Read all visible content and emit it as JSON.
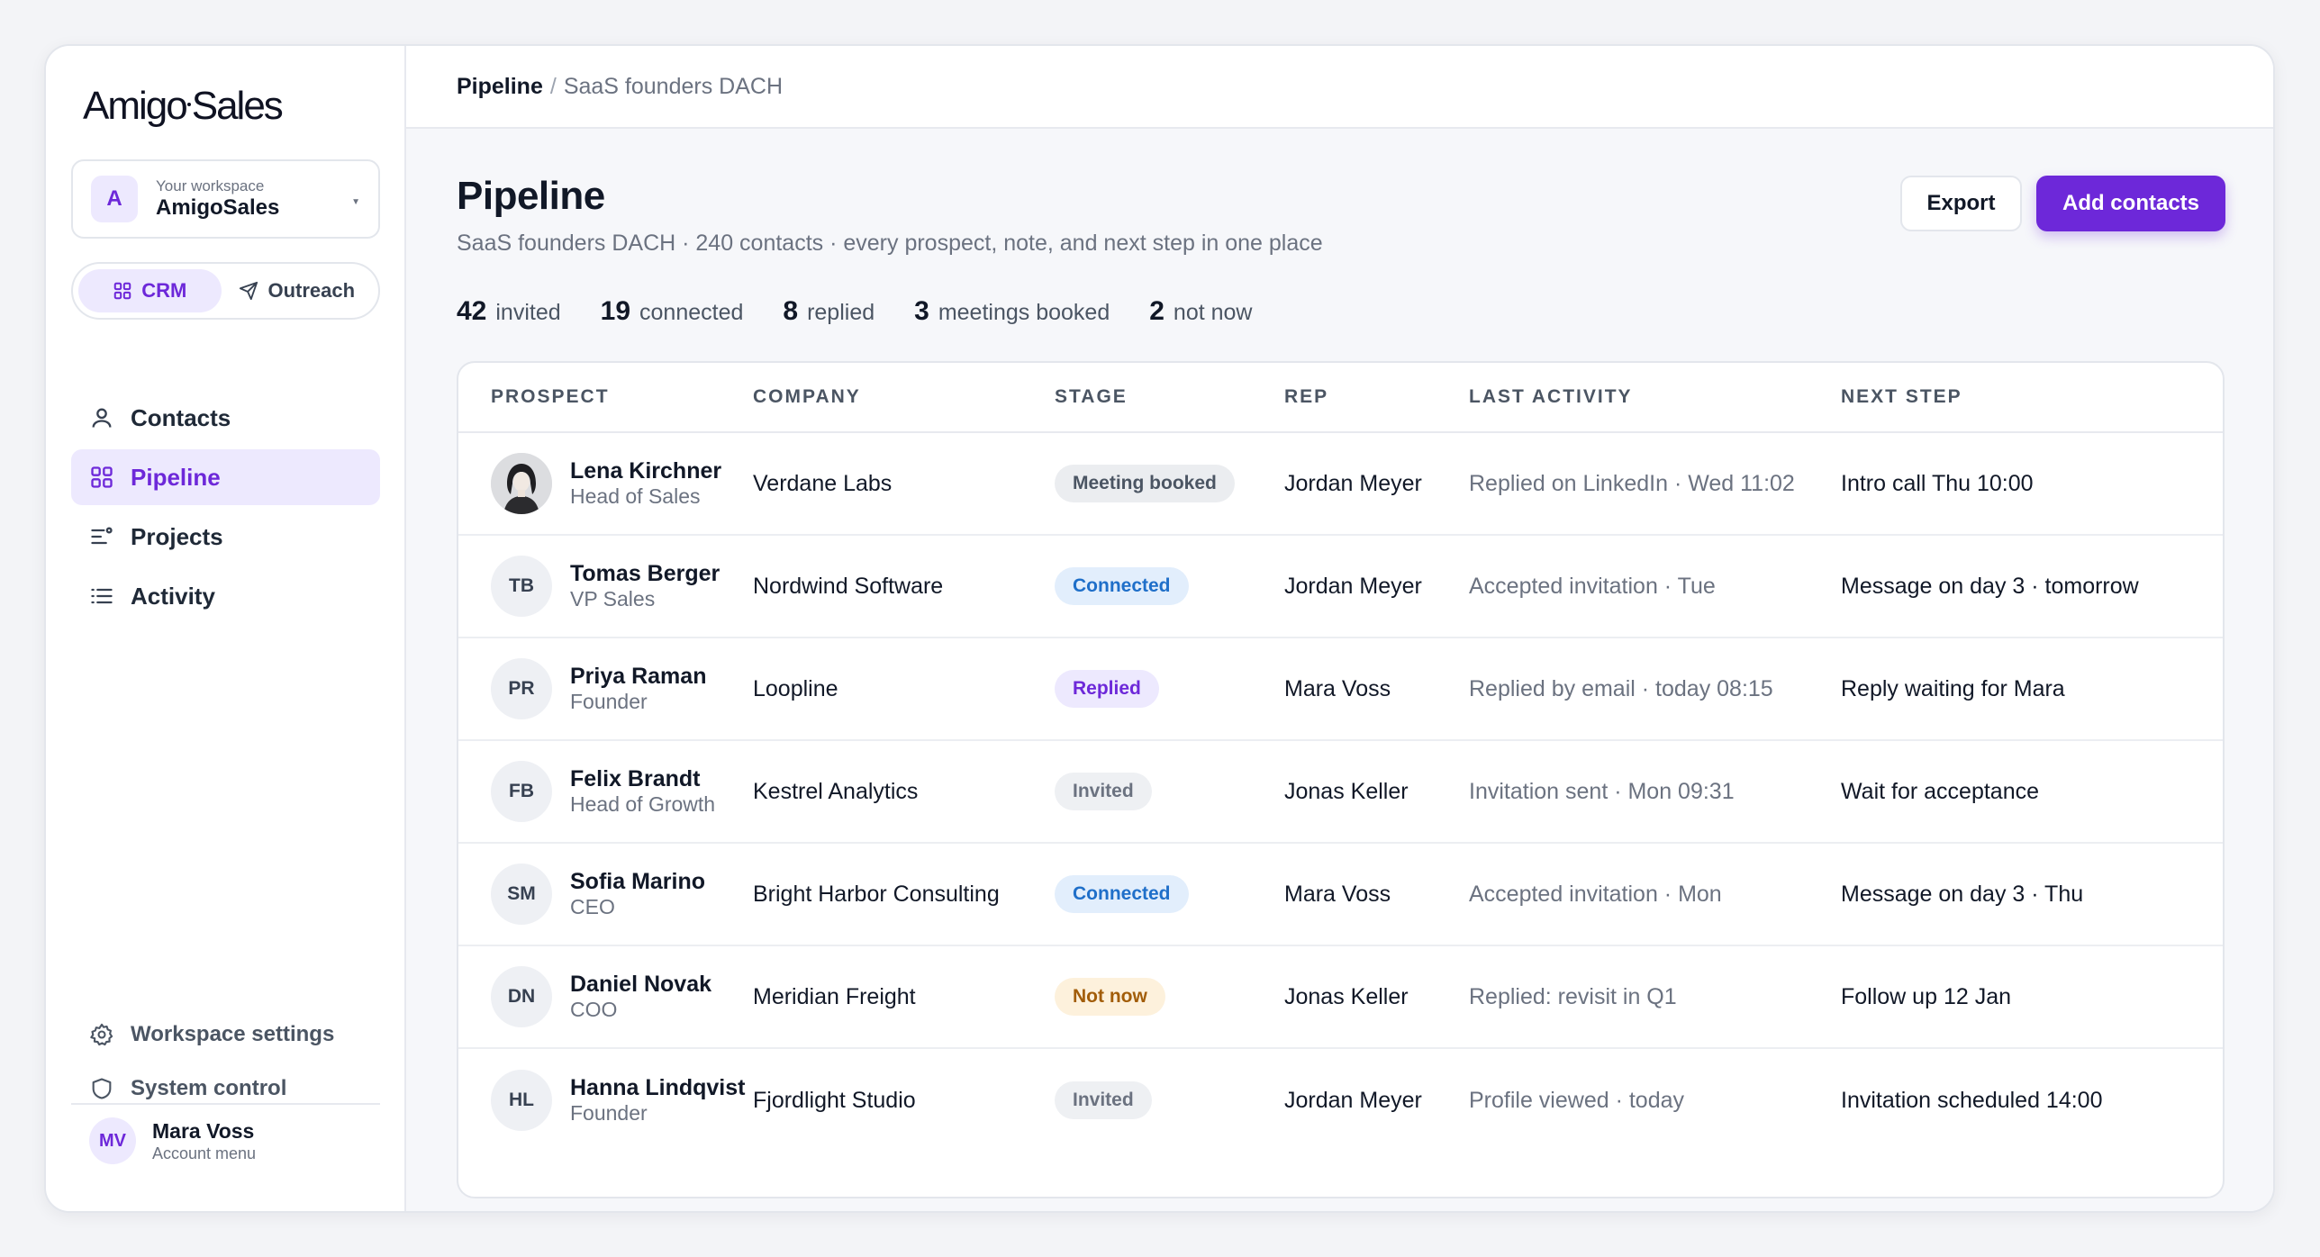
{
  "brand": {
    "logo_left": "Amigo",
    "logo_right": "Sales"
  },
  "workspace": {
    "label": "Your workspace",
    "name": "AmigoSales",
    "initial": "A"
  },
  "mode_switch": {
    "crm": "CRM",
    "outreach": "Outreach"
  },
  "nav": {
    "contacts": "Contacts",
    "pipeline": "Pipeline",
    "projects": "Projects",
    "activity": "Activity"
  },
  "footer_nav": {
    "settings": "Workspace settings",
    "system": "System control"
  },
  "account": {
    "initials": "MV",
    "name": "Mara Voss",
    "sub": "Account menu"
  },
  "breadcrumb": {
    "root": "Pipeline",
    "separator": "/",
    "current": "SaaS founders DACH"
  },
  "page": {
    "title": "Pipeline",
    "subtitle": "SaaS founders DACH · 240 contacts · every prospect, note, and next step in one place",
    "export_label": "Export",
    "add_label": "Add contacts"
  },
  "stats": [
    {
      "num": "42",
      "label": "invited"
    },
    {
      "num": "19",
      "label": "connected"
    },
    {
      "num": "8",
      "label": "replied"
    },
    {
      "num": "3",
      "label": "meetings booked"
    },
    {
      "num": "2",
      "label": "not now"
    }
  ],
  "table": {
    "headers": [
      "PROSPECT",
      "COMPANY",
      "STAGE",
      "REP",
      "LAST ACTIVITY",
      "NEXT STEP"
    ],
    "rows": [
      {
        "initials": "",
        "photo": true,
        "name": "Lena Kirchner",
        "role": "Head of Sales",
        "company": "Verdane Labs",
        "stage": "Meeting booked",
        "stage_kind": "meeting",
        "rep": "Jordan Meyer",
        "last": "Replied on LinkedIn · Wed 11:02",
        "next": "Intro call Thu 10:00"
      },
      {
        "initials": "TB",
        "photo": false,
        "name": "Tomas Berger",
        "role": "VP Sales",
        "company": "Nordwind Software",
        "stage": "Connected",
        "stage_kind": "connected",
        "rep": "Jordan Meyer",
        "last": "Accepted invitation · Tue",
        "next": "Message on day 3 · tomorrow"
      },
      {
        "initials": "PR",
        "photo": false,
        "name": "Priya Raman",
        "role": "Founder",
        "company": "Loopline",
        "stage": "Replied",
        "stage_kind": "replied",
        "rep": "Mara Voss",
        "last": "Replied by email · today 08:15",
        "next": "Reply waiting for Mara"
      },
      {
        "initials": "FB",
        "photo": false,
        "name": "Felix Brandt",
        "role": "Head of Growth",
        "company": "Kestrel Analytics",
        "stage": "Invited",
        "stage_kind": "invited",
        "rep": "Jonas Keller",
        "last": "Invitation sent · Mon 09:31",
        "next": "Wait for acceptance"
      },
      {
        "initials": "SM",
        "photo": false,
        "name": "Sofia Marino",
        "role": "CEO",
        "company": "Bright Harbor Consulting",
        "stage": "Connected",
        "stage_kind": "connected",
        "rep": "Mara Voss",
        "last": "Accepted invitation · Mon",
        "next": "Message on day 3 · Thu"
      },
      {
        "initials": "DN",
        "photo": false,
        "name": "Daniel Novak",
        "role": "COO",
        "company": "Meridian Freight",
        "stage": "Not now",
        "stage_kind": "notnow",
        "rep": "Jonas Keller",
        "last": "Replied: revisit in Q1",
        "next": "Follow up 12 Jan"
      },
      {
        "initials": "HL",
        "photo": false,
        "name": "Hanna Lindqvist",
        "role": "Founder",
        "company": "Fjordlight Studio",
        "stage": "Invited",
        "stage_kind": "invited",
        "rep": "Jordan Meyer",
        "last": "Profile viewed · today",
        "next": "Invitation scheduled 14:00"
      }
    ]
  },
  "colors": {
    "accent": "#6d28d9",
    "accent_soft": "#ede9fe",
    "connected": "#1f6fc9",
    "notnow": "#a25d09"
  }
}
